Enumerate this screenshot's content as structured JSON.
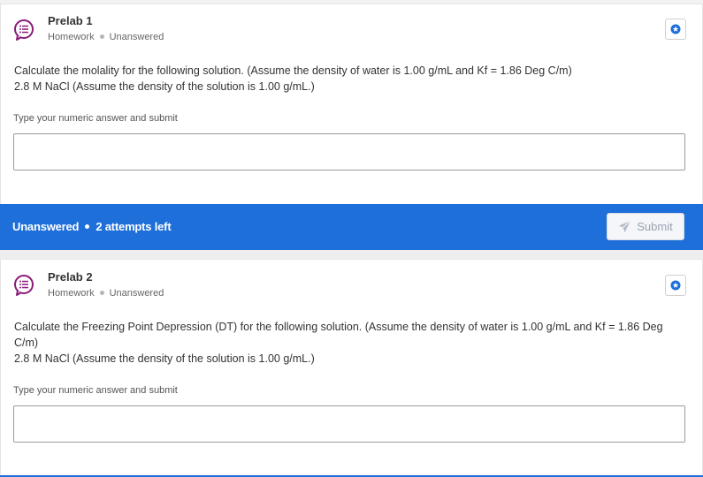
{
  "questions": [
    {
      "title": "Prelab 1",
      "category": "Homework",
      "status": "Unanswered",
      "text_lines": [
        "Calculate the molality for the following solution. (Assume the density of water is 1.00 g/mL and Kf = 1.86 Deg C/m)",
        "2.8 M NaCl (Assume the density of the solution is 1.00 g/mL.)"
      ],
      "answer_label": "Type your numeric answer and submit",
      "answer_value": ""
    },
    {
      "title": "Prelab 2",
      "category": "Homework",
      "status": "Unanswered",
      "text_lines": [
        "Calculate the Freezing Point Depression (DT) for the following solution. (Assume the density of water is 1.00 g/mL and Kf = 1.86 Deg C/m)",
        "2.8 M NaCl (Assume the density of the solution is 1.00 g/mL.)"
      ],
      "answer_label": "Type your numeric answer and submit",
      "answer_value": ""
    }
  ],
  "status_bar": {
    "status": "Unanswered",
    "attempts": "2 attempts left",
    "submit_label": "Submit"
  },
  "icons": {
    "question": "discussion-list-icon",
    "favorite": "star-badge-icon",
    "submit": "paper-plane-icon"
  },
  "colors": {
    "accent_blue": "#1e6fd9",
    "question_icon_purple": "#8a1a7a",
    "submit_disabled_text": "#9ba3b0"
  }
}
